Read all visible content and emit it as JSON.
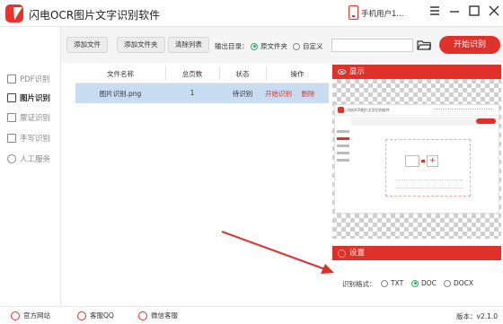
{
  "app": {
    "title": "闪电OCR图片文字识别软件",
    "user": "手机用户1..."
  },
  "window": {
    "menu": "menu-icon",
    "minimize": "minimize-icon",
    "maximize": "maximize-icon",
    "close": "close-icon"
  },
  "sidebar": {
    "items": [
      {
        "label": "PDF识别",
        "icon": "pdf-icon",
        "active": false
      },
      {
        "label": "图片识别",
        "icon": "image-icon",
        "active": true
      },
      {
        "label": "票证识别",
        "icon": "ticket-icon",
        "active": false
      },
      {
        "label": "手写识别",
        "icon": "handwriting-icon",
        "active": false
      },
      {
        "label": "人工服务",
        "icon": "smile-icon",
        "active": false
      }
    ]
  },
  "toolbar": {
    "add_file": "添加文件",
    "add_folder": "添加文件夹",
    "clear_list": "清除列表",
    "output_label": "输出目录：",
    "output_original": "原文件夹",
    "output_custom": "自定义",
    "output_path": "",
    "start": "开始识别"
  },
  "table": {
    "headers": [
      "文件名称",
      "总页数",
      "状态",
      "操作"
    ],
    "rows": [
      {
        "name": "图片识别.png",
        "pages": "1",
        "status": "待识别",
        "action_start": "开始识别",
        "action_delete": "删除"
      }
    ]
  },
  "preview": {
    "header": "显示",
    "mini_title": "闪电OCR图片文字识别软件"
  },
  "settings": {
    "header": "设置",
    "format_label": "识别格式：",
    "formats": [
      "TXT",
      "DOC",
      "DOCX"
    ],
    "selected": "DOC"
  },
  "footer": {
    "website": "官方网站",
    "qq": "客服QQ",
    "wechat": "微信客服",
    "version": "版本：v2.1.0"
  },
  "colors": {
    "accent": "#e0302a",
    "selected_row": "#c9ddf2",
    "radio": "#2eaa5c"
  }
}
